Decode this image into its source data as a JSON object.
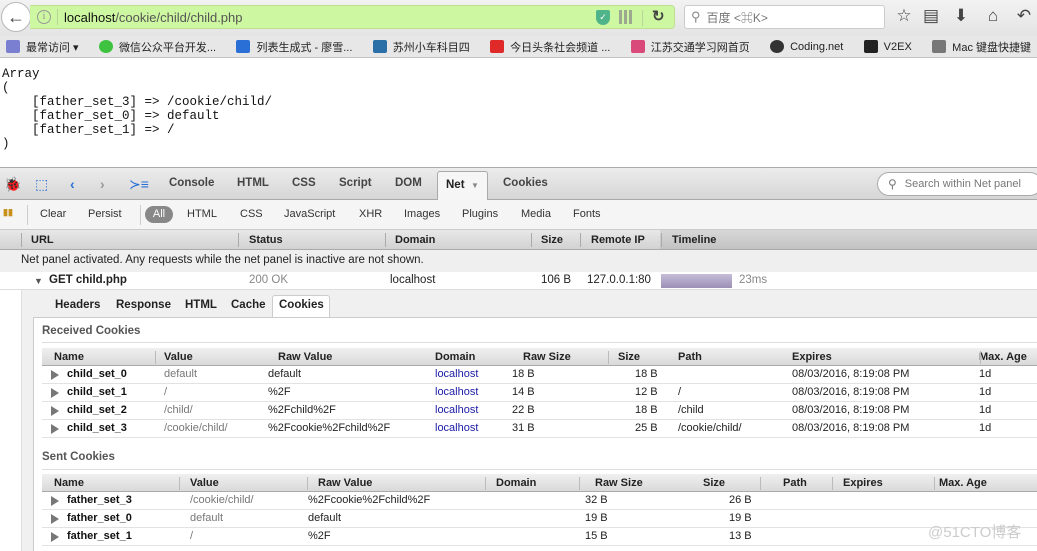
{
  "browser": {
    "url_host": "localhost",
    "url_path": "/cookie/child/child.php",
    "search_placeholder": "百度 <⌘K>",
    "toolbar_icons": [
      "star-icon",
      "clipboard-icon",
      "download-icon",
      "home-icon",
      "undo-icon"
    ]
  },
  "bookmarks": [
    {
      "label": "最常访问 ▾",
      "icon": "folder-icon",
      "color": "#7b7fd1"
    },
    {
      "label": "微信公众平台开发...",
      "icon": "wechat-icon",
      "color": "#3fc23f"
    },
    {
      "label": "列表生成式 - 廖雪...",
      "icon": "rocket-icon",
      "color": "#2a6fd6"
    },
    {
      "label": "苏州小车科目四",
      "icon": "car-icon",
      "color": "#2b6fa6"
    },
    {
      "label": "今日头条社会频道 ...",
      "icon": "toutiao-icon",
      "color": "#e02a2a"
    },
    {
      "label": "江苏交通学习网首页",
      "icon": "jiangsu-icon",
      "color": "#d94a7a"
    },
    {
      "label": "Coding.net",
      "icon": "coding-icon",
      "color": "#333333"
    },
    {
      "label": "V2EX",
      "icon": "v2ex-icon",
      "color": "#222222"
    },
    {
      "label": "Mac 键盘快捷键",
      "icon": "apple-icon",
      "color": "#777777"
    }
  ],
  "page_output": {
    "lines": [
      "Array",
      "(",
      "    [father_set_3] => /cookie/child/",
      "    [father_set_0] => default",
      "    [father_set_1] => /",
      ")"
    ]
  },
  "firebug": {
    "tabs": [
      "Console",
      "HTML",
      "CSS",
      "Script",
      "DOM",
      "Net",
      "Cookies"
    ],
    "active_tab": "Net",
    "search_placeholder": "Search within Net panel",
    "toolbar": {
      "clear": "Clear",
      "persist": "Persist",
      "filters": [
        "All",
        "HTML",
        "CSS",
        "JavaScript",
        "XHR",
        "Images",
        "Plugins",
        "Media",
        "Fonts"
      ],
      "active_filter": "All"
    },
    "net_columns": [
      "URL",
      "Status",
      "Domain",
      "Size",
      "Remote IP",
      "Timeline"
    ],
    "net_info": "Net panel activated. Any requests while the net panel is inactive are not shown.",
    "request": {
      "method_url": "GET child.php",
      "status": "200 OK",
      "domain": "localhost",
      "size": "106 B",
      "remote_ip": "127.0.0.1:80",
      "time": "23ms"
    },
    "detail_tabs": [
      "Headers",
      "Response",
      "HTML",
      "Cache",
      "Cookies"
    ],
    "active_detail_tab": "Cookies",
    "received": {
      "title": "Received Cookies",
      "columns": [
        "Name",
        "Value",
        "Raw Value",
        "Domain",
        "Raw Size",
        "Size",
        "Path",
        "Expires",
        "Max. Age"
      ],
      "rows": [
        {
          "name": "child_set_0",
          "value": "default",
          "raw": "default",
          "domain": "localhost",
          "raw_size": "18 B",
          "size": "18 B",
          "path": "",
          "expires": "08/03/2016, 8:19:08 PM",
          "max_age": "1d"
        },
        {
          "name": "child_set_1",
          "value": "/",
          "raw": "%2F",
          "domain": "localhost",
          "raw_size": "14 B",
          "size": "12 B",
          "path": "/",
          "expires": "08/03/2016, 8:19:08 PM",
          "max_age": "1d"
        },
        {
          "name": "child_set_2",
          "value": "/child/",
          "raw": "%2Fchild%2F",
          "domain": "localhost",
          "raw_size": "22 B",
          "size": "18 B",
          "path": "/child",
          "expires": "08/03/2016, 8:19:08 PM",
          "max_age": "1d"
        },
        {
          "name": "child_set_3",
          "value": "/cookie/child/",
          "raw": "%2Fcookie%2Fchild%2F",
          "domain": "localhost",
          "raw_size": "31 B",
          "size": "25 B",
          "path": "/cookie/child/",
          "expires": "08/03/2016, 8:19:08 PM",
          "max_age": "1d"
        }
      ]
    },
    "sent": {
      "title": "Sent Cookies",
      "columns": [
        "Name",
        "Value",
        "Raw Value",
        "Domain",
        "Raw Size",
        "Size",
        "Path",
        "Expires",
        "Max. Age"
      ],
      "rows": [
        {
          "name": "father_set_3",
          "value": "/cookie/child/",
          "raw": "%2Fcookie%2Fchild%2F",
          "raw_size": "32 B",
          "size": "26 B"
        },
        {
          "name": "father_set_0",
          "value": "default",
          "raw": "default",
          "raw_size": "19 B",
          "size": "19 B"
        },
        {
          "name": "father_set_1",
          "value": "/",
          "raw": "%2F",
          "raw_size": "15 B",
          "size": "13 B"
        }
      ]
    }
  },
  "watermark": "@51CTO博客"
}
